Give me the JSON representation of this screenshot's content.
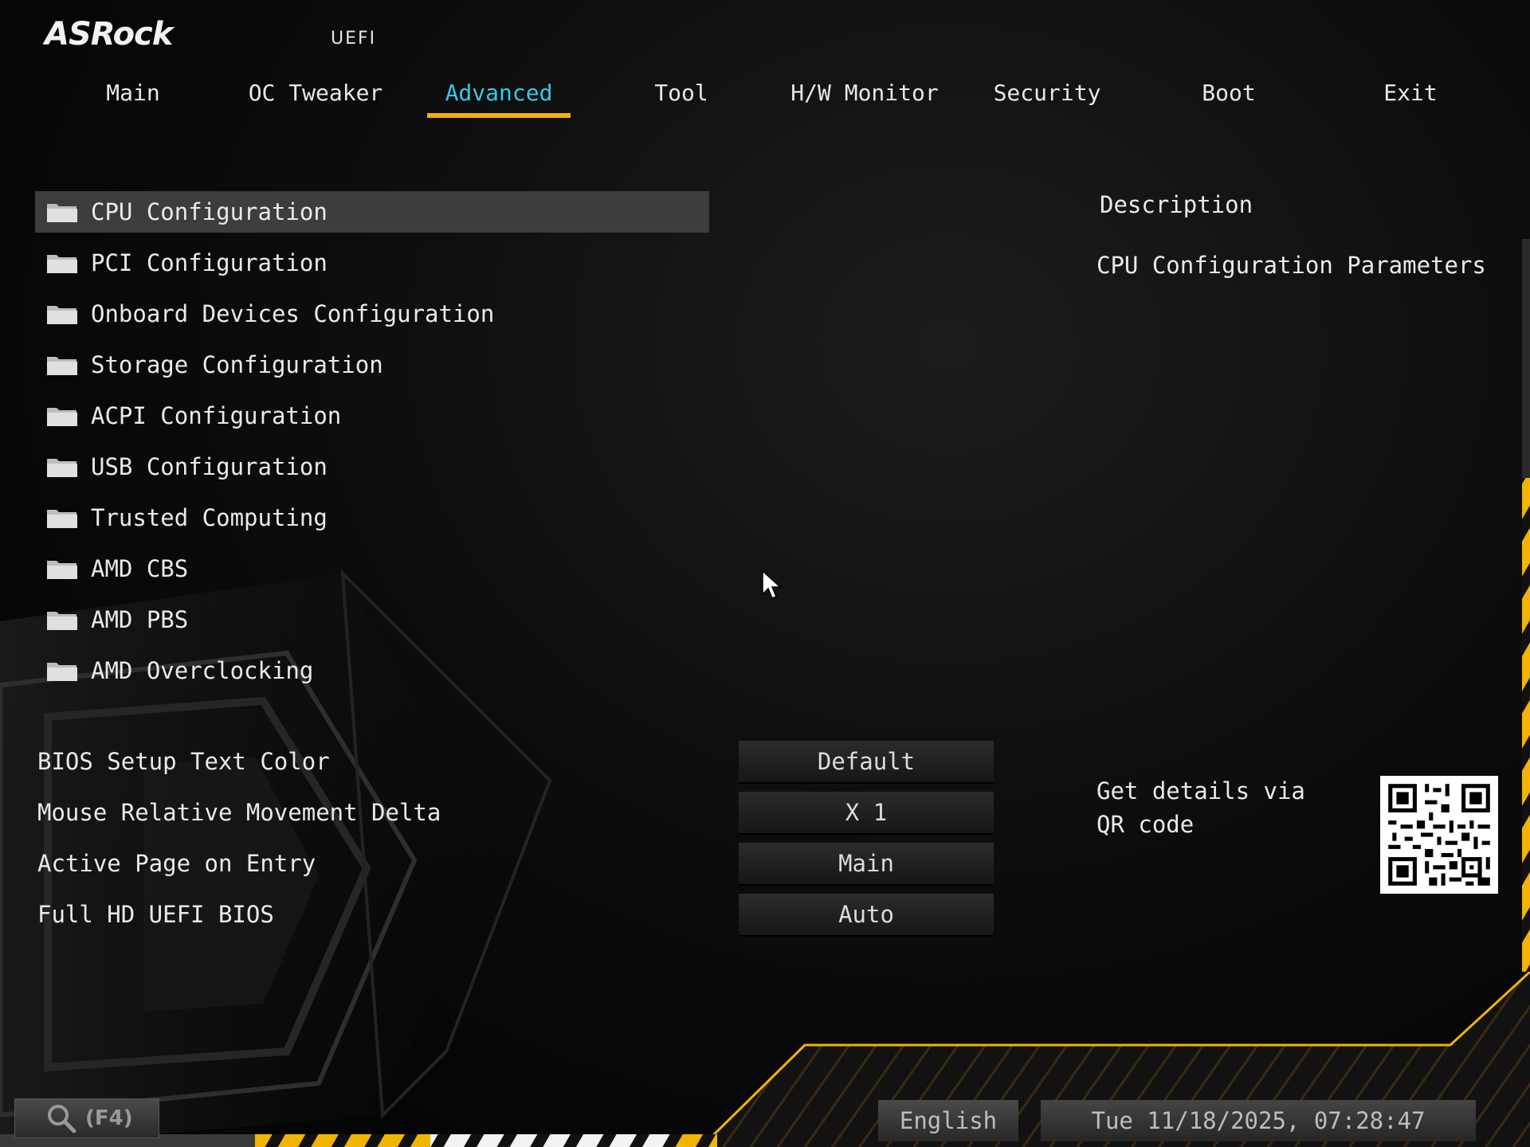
{
  "brand": {
    "logo": "ASRock",
    "product": "UEFI"
  },
  "tabs": [
    {
      "label": "Main",
      "active": false
    },
    {
      "label": "OC Tweaker",
      "active": false
    },
    {
      "label": "Advanced",
      "active": true
    },
    {
      "label": "Tool",
      "active": false
    },
    {
      "label": "H/W Monitor",
      "active": false
    },
    {
      "label": "Security",
      "active": false
    },
    {
      "label": "Boot",
      "active": false
    },
    {
      "label": "Exit",
      "active": false
    }
  ],
  "menu": {
    "items": [
      {
        "label": "CPU Configuration",
        "selected": true
      },
      {
        "label": "PCI Configuration",
        "selected": false
      },
      {
        "label": "Onboard Devices Configuration",
        "selected": false
      },
      {
        "label": "Storage Configuration",
        "selected": false
      },
      {
        "label": "ACPI Configuration",
        "selected": false
      },
      {
        "label": "USB Configuration",
        "selected": false
      },
      {
        "label": "Trusted Computing",
        "selected": false
      },
      {
        "label": "AMD CBS",
        "selected": false
      },
      {
        "label": "AMD PBS",
        "selected": false
      },
      {
        "label": "AMD Overclocking",
        "selected": false
      }
    ]
  },
  "settings": [
    {
      "label": "BIOS Setup Text Color",
      "value": "Default"
    },
    {
      "label": "Mouse Relative Movement Delta",
      "value": "X 1"
    },
    {
      "label": "Active Page on Entry",
      "value": "Main"
    },
    {
      "label": "Full HD UEFI BIOS",
      "value": "Auto"
    }
  ],
  "description": {
    "title": "Description",
    "text": "CPU Configuration Parameters",
    "qr_text": "Get details via QR code"
  },
  "footer": {
    "search_label": "(F4)",
    "language": "English",
    "datetime": "Tue 11/18/2025, 07:28:47"
  },
  "colors": {
    "accent": "#f2b400",
    "active_tab": "#37c8e6",
    "text": "#eaeaea",
    "selected_row": "#3d3d3d"
  },
  "icons": {
    "menu_item": "folder-icon",
    "search": "search-icon",
    "pointer": "cursor-icon",
    "qr": "qr-code-icon"
  }
}
